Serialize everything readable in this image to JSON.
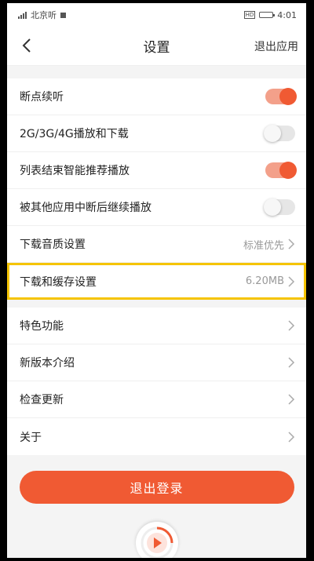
{
  "status_bar": {
    "signal": "ᵃᵢ",
    "carrier": "北京听",
    "time": "4:01",
    "hd_label": "HD"
  },
  "navbar": {
    "title": "设置",
    "right_action": "退出应用"
  },
  "group1": [
    {
      "label": "断点续听",
      "toggle": "on"
    },
    {
      "label": "2G/3G/4G播放和下载",
      "toggle": "off"
    },
    {
      "label": "列表结束智能推荐播放",
      "toggle": "on"
    },
    {
      "label": "被其他应用中断后继续播放",
      "toggle": "off"
    },
    {
      "label": "下载音质设置",
      "value": "标准优先"
    },
    {
      "label": "下载和缓存设置",
      "value": "6.20MB"
    }
  ],
  "group2": [
    {
      "label": "特色功能"
    },
    {
      "label": "新版本介绍"
    },
    {
      "label": "检查更新"
    },
    {
      "label": "关于"
    }
  ],
  "logout_button": "退出登录",
  "colors": {
    "accent": "#f05a33",
    "highlight": "#f5c400"
  }
}
